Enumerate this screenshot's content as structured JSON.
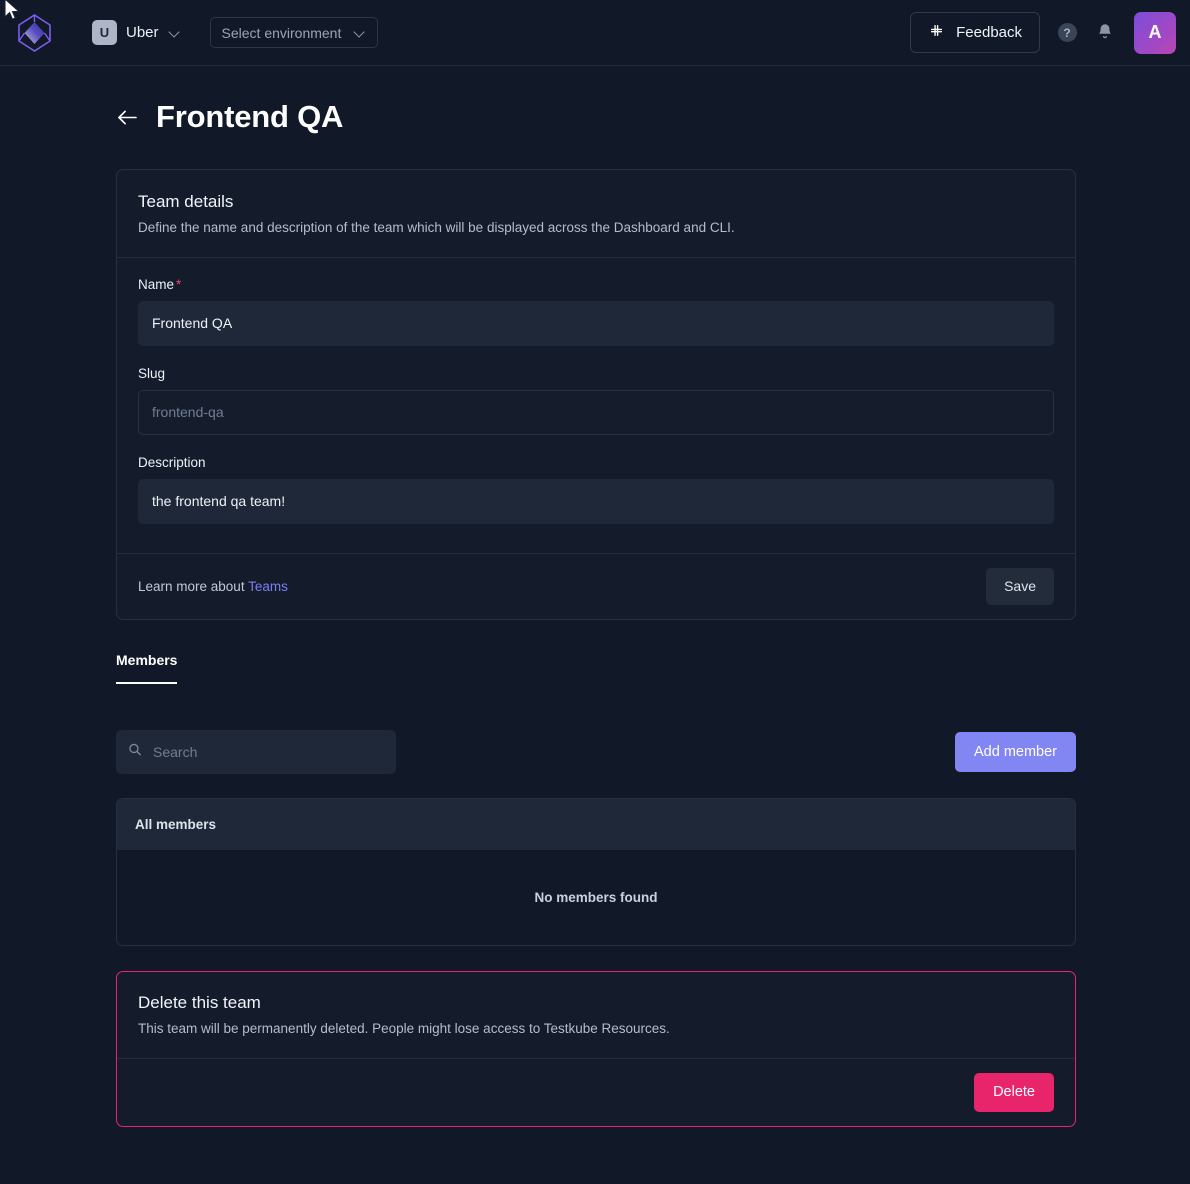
{
  "header": {
    "logo_icon": "testkube-cube-logo",
    "org": {
      "initial": "U",
      "name": "Uber",
      "chevron_icon": "chevron-down-icon"
    },
    "environment_select": {
      "label": "Select environment",
      "chevron_icon": "chevron-down-icon"
    },
    "feedback": {
      "label": "Feedback",
      "icon": "slack-icon"
    },
    "help": {
      "label": "?",
      "icon": "help-circle-icon"
    },
    "notifications": {
      "icon": "bell-icon"
    },
    "user_avatar": {
      "initial": "A"
    }
  },
  "page": {
    "back_icon": "arrow-left-icon",
    "title": "Frontend QA"
  },
  "team_details": {
    "title": "Team details",
    "subtitle": "Define the name and description of the team which will be displayed across the Dashboard and CLI.",
    "fields": {
      "name": {
        "label": "Name",
        "required_mark": "*",
        "value": "Frontend QA",
        "placeholder": ""
      },
      "slug": {
        "label": "Slug",
        "value": "",
        "placeholder": "frontend-qa"
      },
      "description": {
        "label": "Description",
        "value": "the frontend qa team!",
        "placeholder": ""
      }
    },
    "footer": {
      "learn_prefix": "Learn more about ",
      "learn_link": "Teams",
      "save_label": "Save"
    }
  },
  "tabs": [
    {
      "label": "Members",
      "active": true
    }
  ],
  "members": {
    "search": {
      "placeholder": "Search",
      "value": "",
      "icon": "search-icon"
    },
    "add_button": "Add member",
    "table": {
      "header": "All members",
      "empty_text": "No members found",
      "rows": []
    }
  },
  "danger_zone": {
    "title": "Delete this team",
    "subtitle": "This team will be permanently deleted. People might lose access to Testkube Resources.",
    "delete_label": "Delete"
  },
  "colors": {
    "page_bg": "#111827",
    "card_bg": "#141c2c",
    "card_border": "#26303f",
    "input_bg": "#1e2838",
    "accent_primary": "#8286f2",
    "link": "#7b7ef0",
    "danger": "#e8246b",
    "required": "#f2426b"
  }
}
